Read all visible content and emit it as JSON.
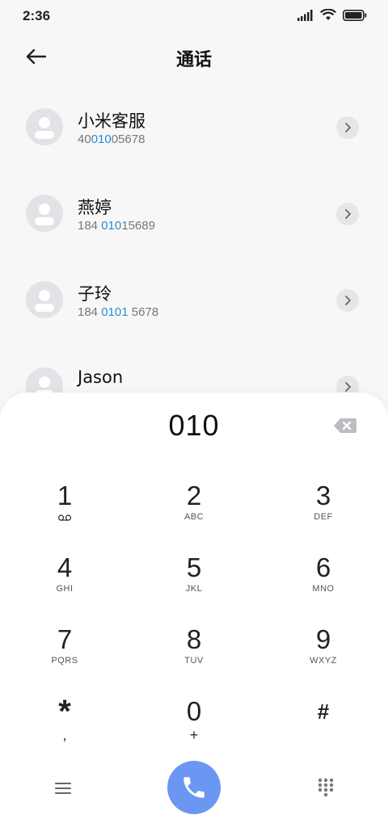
{
  "status": {
    "time": "2:36",
    "icons": [
      "signal-icon",
      "wifi-icon",
      "battery-icon"
    ]
  },
  "header": {
    "title": "通话",
    "back_icon": "back-arrow-icon"
  },
  "contacts": [
    {
      "name": "小米客服",
      "number_parts": [
        "40",
        "010",
        "05678"
      ]
    },
    {
      "name": "燕婷",
      "number_parts": [
        "184 ",
        "010",
        "15689"
      ]
    },
    {
      "name": "子玲",
      "number_parts": [
        "184 ",
        "0101",
        " 5678"
      ]
    },
    {
      "name": "Jason",
      "number_parts": [
        "",
        "",
        ""
      ]
    }
  ],
  "dialpad": {
    "dialed_number": "010",
    "keys": [
      {
        "digit": "1",
        "letters": "",
        "icon": "voicemail-icon"
      },
      {
        "digit": "2",
        "letters": "ABC"
      },
      {
        "digit": "3",
        "letters": "DEF"
      },
      {
        "digit": "4",
        "letters": "GHI"
      },
      {
        "digit": "5",
        "letters": "JKL"
      },
      {
        "digit": "6",
        "letters": "MNO"
      },
      {
        "digit": "7",
        "letters": "PQRS"
      },
      {
        "digit": "8",
        "letters": "TUV"
      },
      {
        "digit": "9",
        "letters": "WXYZ"
      },
      {
        "digit": "*",
        "letters": ","
      },
      {
        "digit": "0",
        "letters": "+"
      },
      {
        "digit": "#",
        "letters": ""
      }
    ]
  },
  "colors": {
    "accent": "#2a8ad6",
    "call_button": "#6b97f2",
    "background": "#f7f7f7",
    "sheet": "#ffffff"
  }
}
